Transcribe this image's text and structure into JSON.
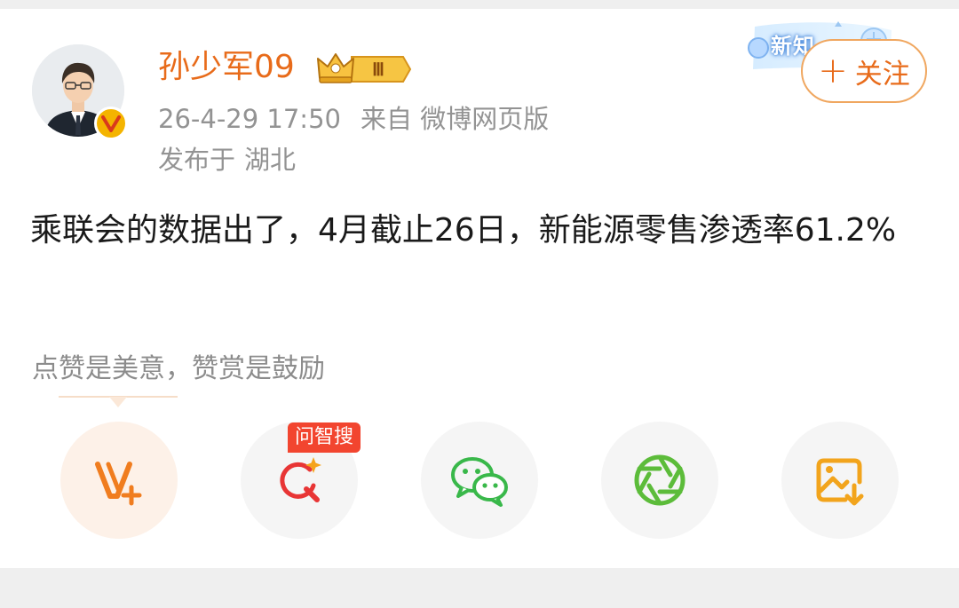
{
  "post": {
    "author": {
      "name": "孙少军09",
      "avatar_icon": "user-avatar-photo",
      "verified_icon": "verified-v-icon",
      "vip_badge": {
        "icon": "crown-icon",
        "level": "Ⅲ"
      }
    },
    "meta": {
      "time": "26-4-29 17:50",
      "source": "来自 微博网页版"
    },
    "location": {
      "label": "发布于",
      "place": "湖北"
    },
    "promo_banner": "新知",
    "follow_button": {
      "icon": "plus-icon",
      "label": "关注"
    },
    "text": "乘联会的数据出了，4月截止26日，新能源零售渗透率61.2%",
    "reward_hint": "点赞是美意，赞赏是鼓励"
  },
  "actions": [
    {
      "name": "weibo-vip-plus",
      "icon": "v-plus-icon",
      "color": "#f07d1f"
    },
    {
      "name": "ask-smart-search",
      "icon": "ai-search-icon",
      "tag": "问智搜",
      "color": "#e83535"
    },
    {
      "name": "wechat-share",
      "icon": "wechat-icon",
      "color": "#39b84a"
    },
    {
      "name": "moments-share",
      "icon": "moments-icon",
      "color": "#5cbc3a"
    },
    {
      "name": "save-image",
      "icon": "save-image-icon",
      "color": "#f2a41c"
    }
  ],
  "colors": {
    "accent": "#e86b1a",
    "meta_text": "#939393",
    "body_text": "#1a1a1a",
    "page_bg": "#efefef",
    "tag_red": "#f2452f"
  }
}
